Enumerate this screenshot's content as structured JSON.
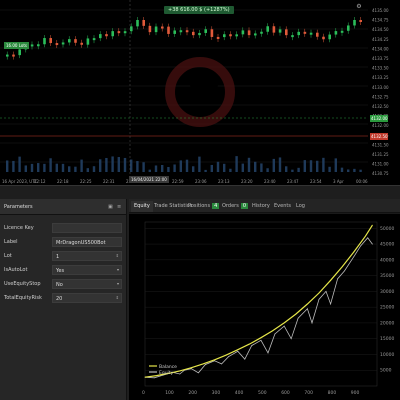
{
  "price_chart": {
    "gain_label": "+38 616.00 $ (+1287%)",
    "symbol_badge": "16.00 Lots",
    "cursor_time": "16/04/2021 22:00",
    "current_price_green": "4132.00",
    "current_price_red": "4132.50",
    "x_ticks": [
      "16 Apr 2023, UTC",
      "22:12",
      "22:18",
      "22:25",
      "22:31",
      "22:38",
      "22:53",
      "22:59",
      "23:06",
      "23:13",
      "23:20",
      "23:40",
      "23:47",
      "23:54",
      "3 Apr",
      "00:06"
    ],
    "y_ticks": [
      "4135.00",
      "4134.75",
      "4134.50",
      "4134.25",
      "4134.00",
      "4133.75",
      "4133.50",
      "4133.25",
      "4133.00",
      "4132.75",
      "4132.50",
      "4132.25",
      "4132.00",
      "4131.75",
      "4131.50",
      "4131.25",
      "4131.00",
      "4130.75"
    ],
    "colors": {
      "up": "#2bbd5a",
      "down": "#e05a3a",
      "background": "#000000"
    }
  },
  "params_panel": {
    "title": "Parameters",
    "rows": [
      {
        "label": "Licence Key",
        "value": ""
      },
      {
        "label": "Label",
        "value": "MrDragonUS500Bot"
      },
      {
        "label": "Lot",
        "value": "1"
      },
      {
        "label": "IsAutoLot",
        "value": "Yes"
      },
      {
        "label": "UseEquityStop",
        "value": "No"
      },
      {
        "label": "TotalEquityRisk",
        "value": "20"
      }
    ]
  },
  "results_panel": {
    "tabs": [
      {
        "label": "Equity",
        "active": true
      },
      {
        "label": "Trade Statistics"
      },
      {
        "label": "Positions",
        "count": "4"
      },
      {
        "label": "Orders",
        "count": "0"
      },
      {
        "label": "History"
      },
      {
        "label": "Events"
      },
      {
        "label": "Log"
      }
    ]
  },
  "chart_data": {
    "type": "line",
    "x_ticks": [
      0,
      100,
      200,
      300,
      400,
      500,
      600,
      700,
      800,
      900
    ],
    "y_ticks": [
      5000,
      10000,
      15000,
      20000,
      25000,
      30000,
      35000,
      40000,
      45000,
      50000
    ],
    "xlim": [
      0,
      1000
    ],
    "ylim": [
      0,
      52000
    ],
    "series": [
      {
        "name": "Balance",
        "color": "#e6e64a",
        "x": [
          0,
          50,
          100,
          150,
          200,
          250,
          300,
          350,
          400,
          450,
          500,
          550,
          600,
          650,
          700,
          750,
          800,
          850,
          900,
          950,
          980
        ],
        "y": [
          2800,
          3300,
          4000,
          4800,
          5800,
          7000,
          8300,
          9800,
          11500,
          13300,
          15300,
          17500,
          20000,
          22800,
          26000,
          29500,
          33500,
          37800,
          42500,
          47500,
          51000
        ]
      },
      {
        "name": "Equity",
        "color": "#bdbdbd",
        "x": [
          0,
          40,
          80,
          120,
          150,
          170,
          200,
          230,
          260,
          300,
          330,
          360,
          400,
          430,
          460,
          500,
          530,
          560,
          600,
          630,
          660,
          700,
          720,
          750,
          780,
          800,
          830,
          860,
          900,
          930,
          960,
          980
        ],
        "y": [
          2800,
          2600,
          3500,
          4300,
          3800,
          5000,
          5500,
          4200,
          6800,
          8000,
          7000,
          9300,
          11000,
          8500,
          12800,
          14500,
          10500,
          16500,
          19000,
          15000,
          21500,
          24500,
          20000,
          27500,
          30000,
          26000,
          34000,
          36500,
          41000,
          44500,
          47000,
          45000
        ]
      }
    ]
  }
}
